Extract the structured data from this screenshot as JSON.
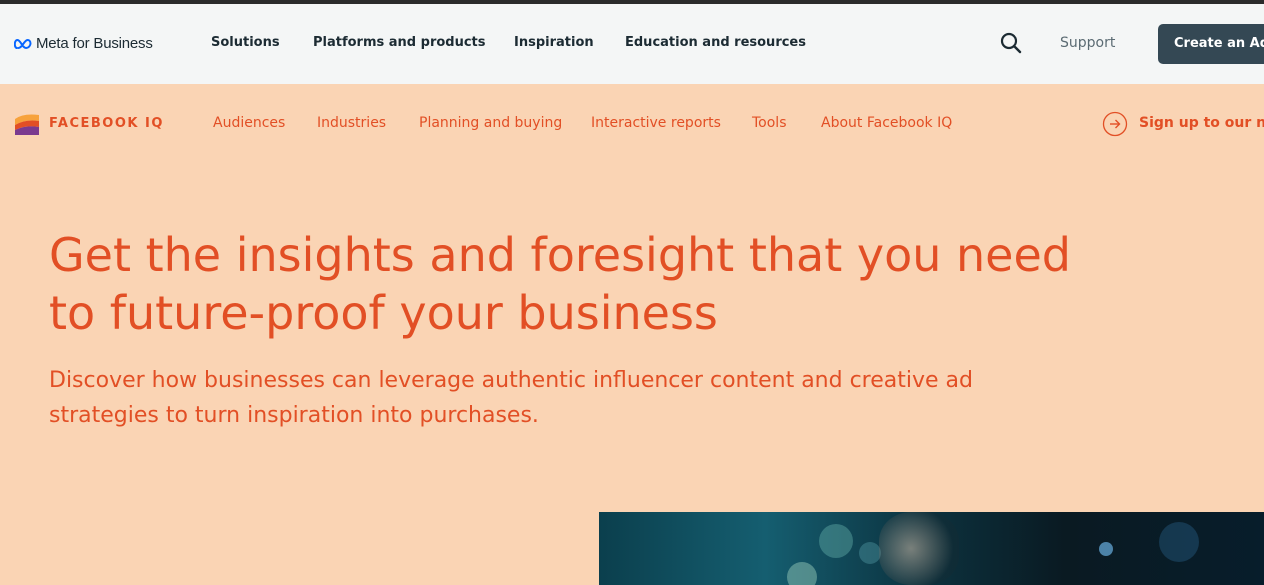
{
  "topnav": {
    "logo_text": "Meta for Business",
    "items": [
      {
        "label": "Solutions"
      },
      {
        "label": "Platforms and products"
      },
      {
        "label": "Inspiration"
      },
      {
        "label": "Education and resources"
      }
    ],
    "support_label": "Support",
    "create_ad_label": "Create an Ad"
  },
  "subnav": {
    "brand": "FACEBOOK IQ",
    "items": [
      {
        "label": "Audiences"
      },
      {
        "label": "Industries"
      },
      {
        "label": "Planning and buying"
      },
      {
        "label": "Interactive reports"
      },
      {
        "label": "Tools"
      },
      {
        "label": "About Facebook IQ"
      }
    ],
    "signup_label": "Sign up to our new"
  },
  "hero": {
    "title_line1": "Get the insights and foresight that you need",
    "title_line2": "to future-proof your business",
    "subtitle_line1": "Discover how businesses can leverage authentic influencer content and creative ad",
    "subtitle_line2": "strategies to turn inspiration into purchases."
  },
  "colors": {
    "accent": "#e24f25",
    "background": "#fad4b4",
    "nav_bg": "#f4f6f6",
    "button_bg": "#344854"
  },
  "icons": {
    "meta_logo": "meta-infinity-icon",
    "search": "search-icon",
    "iq_logo": "facebook-iq-icon",
    "signup": "arrow-circle-icon"
  }
}
